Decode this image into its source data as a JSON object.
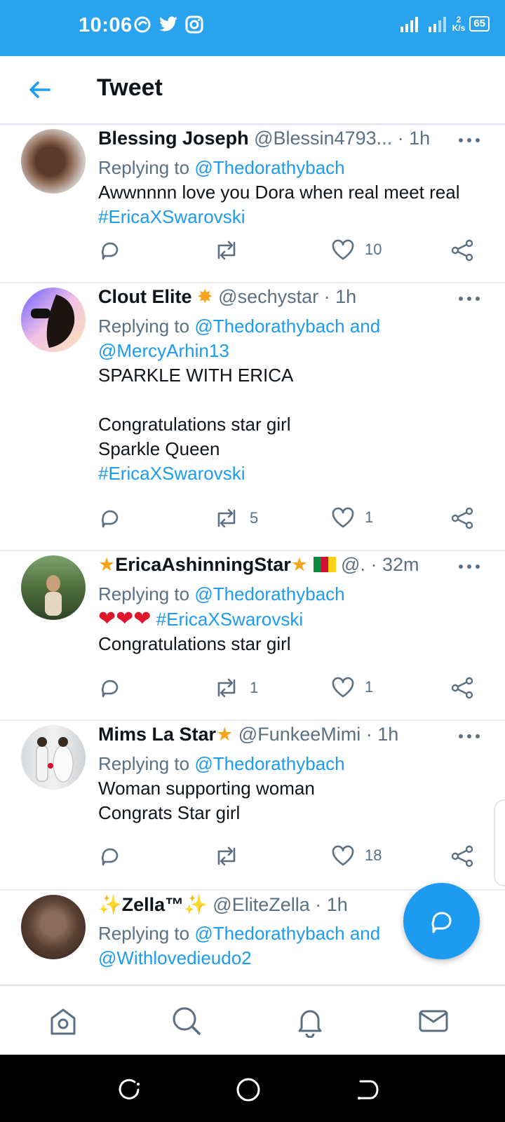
{
  "status_bar": {
    "time": "10:06",
    "network_speed_value": "2",
    "network_speed_unit": "K/s",
    "battery": "65"
  },
  "header": {
    "title": "Tweet"
  },
  "tweets": [
    {
      "name": "Blessing Joseph",
      "handle": "@Blessin4793...",
      "time": "· 1h",
      "replying_prefix": "Replying to ",
      "replying_to": "@Thedorathybach",
      "text_lines": [
        "Awwnnnn love you Dora when real meet real"
      ],
      "hashtag": "#EricaXSwarovski",
      "retweets": "",
      "likes": "10"
    },
    {
      "name": "Clout Elite",
      "handle": "@sechystar",
      "time": "· 1h",
      "replying_prefix": "Replying to ",
      "replying_to": "@Thedorathybach and",
      "replying_to_2": "@MercyArhin13",
      "text_lines": [
        "SPARKLE WITH ERICA",
        "",
        "Congratulations star girl",
        "Sparkle Queen"
      ],
      "hashtag": "#EricaXSwarovski",
      "retweets": "5",
      "likes": "1"
    },
    {
      "name": "EricaAshinningStar",
      "handle": "@.",
      "time": "· 32m",
      "replying_prefix": "Replying to ",
      "replying_to": "@Thedorathybach",
      "hashtag": "#EricaXSwarovski",
      "text_lines": [
        "Congratulations star girl"
      ],
      "retweets": "1",
      "likes": "1"
    },
    {
      "name": "Mims La Star",
      "handle": "@FunkeeMimi",
      "time": "· 1h",
      "replying_prefix": "Replying to ",
      "replying_to": "@Thedorathybach",
      "text_lines": [
        "Woman supporting woman",
        "Congrats Star girl"
      ],
      "retweets": "",
      "likes": "18"
    },
    {
      "name": "Zella™",
      "handle": "@EliteZella",
      "time": "· 1h",
      "replying_prefix": "Replying to ",
      "replying_to": "@Thedorathybach and",
      "replying_to_2": "@Withlovedieudo2"
    }
  ],
  "icons": {
    "back": "arrow-left-icon",
    "more": "more-horizontal-icon",
    "reply": "reply-bubble-icon",
    "retweet": "retweet-icon",
    "like": "heart-icon",
    "share": "share-icon",
    "compose": "compose-reply-icon",
    "nav": [
      "home-icon",
      "search-icon",
      "notifications-icon",
      "messages-icon"
    ]
  },
  "colors": {
    "status_bar": "#2aa3ef",
    "accent": "#1d9bf0",
    "muted": "#5b7083",
    "heart_emoji": "#e0162b",
    "star_emoji": "#f7a41d"
  }
}
